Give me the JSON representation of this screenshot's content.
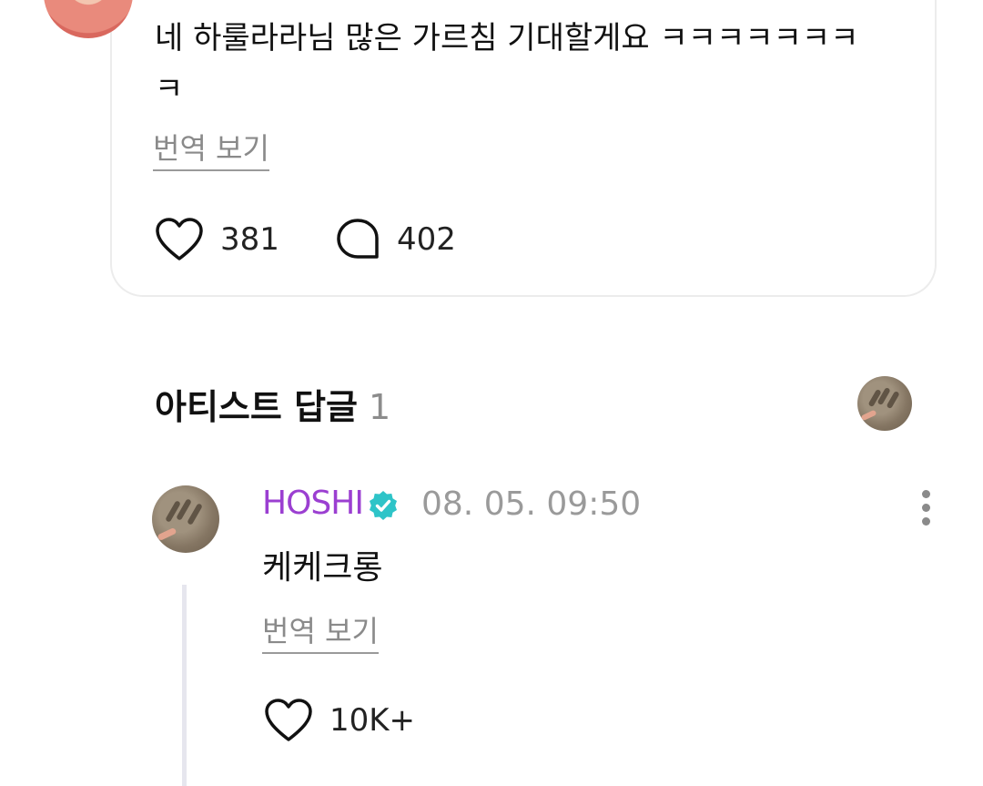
{
  "comment": {
    "text": "네 하룰라라님 많은 가르침 기대할게요 ㅋㅋㅋㅋㅋㅋㅋㅋ",
    "translate_label": "번역 보기",
    "likes": "381",
    "replies": "402"
  },
  "artist_replies": {
    "title": "아티스트 답글",
    "count": "1"
  },
  "reply": {
    "author": "HOSHI",
    "timestamp": "08. 05. 09:50",
    "text": "케케크롱",
    "translate_label": "번역 보기",
    "likes": "10K+"
  },
  "colors": {
    "artist_name": "#9b3fd1",
    "verified_badge": "#2ec4c8",
    "muted_text": "#8a8a8a",
    "thread_line": "#e6e6ee"
  },
  "icons": [
    "heart-icon",
    "comment-bubble-icon",
    "verified-badge-icon",
    "more-vertical-icon"
  ]
}
